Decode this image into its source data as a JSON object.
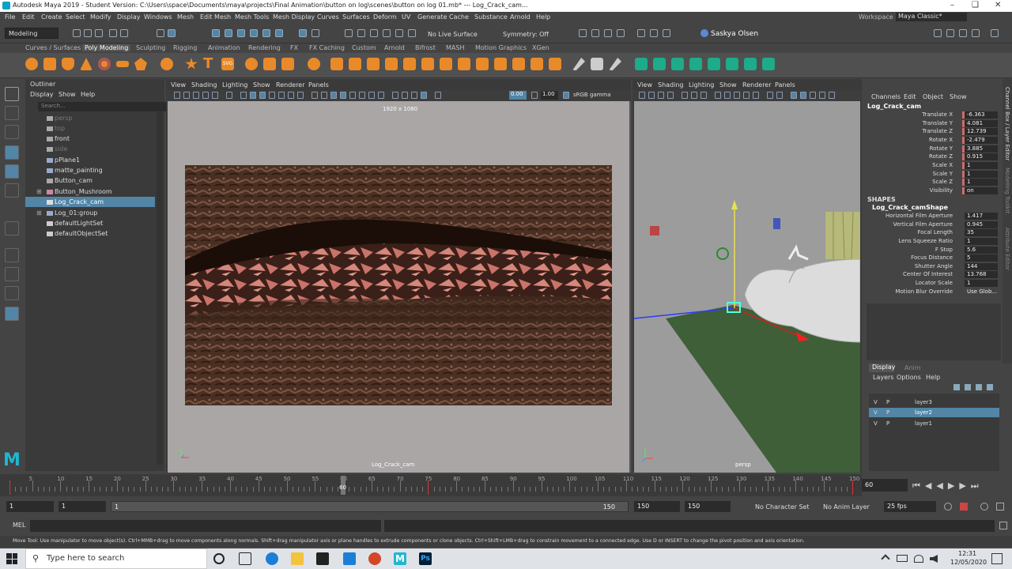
{
  "titlebar": {
    "title": "Autodesk Maya 2019 - Student Version: C:\\Users\\space\\Documents\\maya\\projects\\Final Animation\\button on log\\scenes\\button on log 01.mb*   ---   Log_Crack_cam..."
  },
  "menubar": {
    "items": [
      "File",
      "Edit",
      "Create",
      "Select",
      "Modify",
      "Display",
      "Windows",
      "Mesh",
      "Edit Mesh",
      "Mesh Tools",
      "Mesh Display",
      "Curves",
      "Surfaces",
      "Deform",
      "UV",
      "Generate",
      "Cache",
      "Substance",
      "Arnold",
      "Help"
    ],
    "workspace_label": "Workspace :",
    "workspace_value": "Maya Classic*"
  },
  "statusline": {
    "mode": "Modeling",
    "live_surface": "No Live Surface",
    "symmetry": "Symmetry: Off",
    "user": "Saskya Olsen"
  },
  "shelf_tabs": [
    "Curves / Surfaces",
    "Poly Modeling",
    "Sculpting",
    "Rigging",
    "Animation",
    "Rendering",
    "FX",
    "FX Caching",
    "Custom",
    "Arnold",
    "Bifrost",
    "MASH",
    "Motion Graphics",
    "XGen"
  ],
  "outliner": {
    "title": "Outliner",
    "menu": [
      "Display",
      "Show",
      "Help"
    ],
    "search_placeholder": "Search...",
    "items": [
      {
        "label": "persp",
        "dim": true
      },
      {
        "label": "top",
        "dim": true
      },
      {
        "label": "front",
        "dim": false
      },
      {
        "label": "side",
        "dim": true
      },
      {
        "label": "pPlane1",
        "dim": false
      },
      {
        "label": "matte_painting",
        "dim": false
      },
      {
        "label": "Button_cam",
        "dim": false
      },
      {
        "label": "Button_Mushroom",
        "dim": false
      },
      {
        "label": "Log_Crack_cam",
        "dim": false,
        "selected": true
      },
      {
        "label": "Log_01:group",
        "dim": false
      },
      {
        "label": "defaultLightSet",
        "dim": false
      },
      {
        "label": "defaultObjectSet",
        "dim": false
      }
    ]
  },
  "viewport_left": {
    "menu": [
      "View",
      "Shading",
      "Lighting",
      "Show",
      "Renderer",
      "Panels"
    ],
    "field_value": "0.00",
    "gamma_value": "1.00",
    "color_space": "sRGB gamma",
    "resolution": "1920 x 1080",
    "camera_label": "Log_Crack_cam"
  },
  "viewport_right": {
    "menu": [
      "View",
      "Shading",
      "Lighting",
      "Show",
      "Renderer",
      "Panels"
    ],
    "camera_label": "persp"
  },
  "channels": {
    "menu": [
      "Channels",
      "Edit",
      "Object",
      "Show"
    ],
    "object_name": "Log_Crack_cam",
    "transforms": [
      {
        "label": "Translate X",
        "value": "-6.363"
      },
      {
        "label": "Translate Y",
        "value": "4.081"
      },
      {
        "label": "Translate Z",
        "value": "12.739"
      },
      {
        "label": "Rotate X",
        "value": "-2.479"
      },
      {
        "label": "Rotate Y",
        "value": "3.885"
      },
      {
        "label": "Rotate Z",
        "value": "0.915"
      },
      {
        "label": "Scale X",
        "value": "1"
      },
      {
        "label": "Scale Y",
        "value": "1"
      },
      {
        "label": "Scale Z",
        "value": "1"
      },
      {
        "label": "Visibility",
        "value": "on"
      }
    ],
    "shapes_header": "SHAPES",
    "shape_name": "Log_Crack_camShape",
    "shape_attrs": [
      {
        "label": "Horizontal Film Aperture",
        "value": "1.417"
      },
      {
        "label": "Vertical Film Aperture",
        "value": "0.945"
      },
      {
        "label": "Focal Length",
        "value": "35"
      },
      {
        "label": "Lens Squeeze Ratio",
        "value": "1"
      },
      {
        "label": "F Stop",
        "value": "5.6"
      },
      {
        "label": "Focus Distance",
        "value": "5"
      },
      {
        "label": "Shutter Angle",
        "value": "144"
      },
      {
        "label": "Center Of Interest",
        "value": "13.768"
      },
      {
        "label": "Locator Scale",
        "value": "1"
      },
      {
        "label": "Motion Blur Override",
        "value": "Use Glob..."
      }
    ],
    "side_tabs": [
      "Channel Box / Layer Editor",
      "Modelling Toolkit",
      "Attribute Editor"
    ]
  },
  "layers": {
    "tabs": [
      "Display",
      "Anim"
    ],
    "menu": [
      "Layers",
      "Options",
      "Help"
    ],
    "items": [
      {
        "v": "V",
        "p": "P",
        "name": "layer3",
        "selected": false
      },
      {
        "v": "V",
        "p": "P",
        "name": "layer2",
        "selected": true
      },
      {
        "v": "V",
        "p": "P",
        "name": "layer1",
        "selected": false
      }
    ]
  },
  "timeline": {
    "ticks": [
      "5",
      "10",
      "15",
      "20",
      "25",
      "30",
      "35",
      "40",
      "45",
      "50",
      "55",
      "60",
      "65",
      "70",
      "75",
      "80",
      "85",
      "90",
      "95",
      "100",
      "105",
      "110",
      "115",
      "120",
      "125",
      "130",
      "135",
      "140",
      "145",
      "150"
    ],
    "current_frame_marker": "60",
    "current_frame_field": "60"
  },
  "range": {
    "start": "1",
    "start_inner": "1",
    "slider_start": "1",
    "slider_end": "150",
    "end_inner": "150",
    "end": "150",
    "character_set": "No Character Set",
    "anim_layer": "No Anim Layer",
    "fps": "25 fps"
  },
  "cmdline": {
    "label": "MEL"
  },
  "helpline": {
    "text": "Move Tool: Use manipulator to move object(s). Ctrl+MMB+drag to move components along normals. Shift+drag manipulator axis or plane handles to extrude components or clone objects. Ctrl+Shift+LMB+drag to constrain movement to a connected edge. Use D or INSERT to change the pivot position and axis orientation."
  },
  "taskbar": {
    "search_placeholder": "Type here to search",
    "time": "12:31",
    "date": "12/05/2020"
  },
  "colors": {
    "accent": "#5285a6",
    "key_red": "#d06a6a",
    "maya_teal": "#0aa3c2"
  }
}
